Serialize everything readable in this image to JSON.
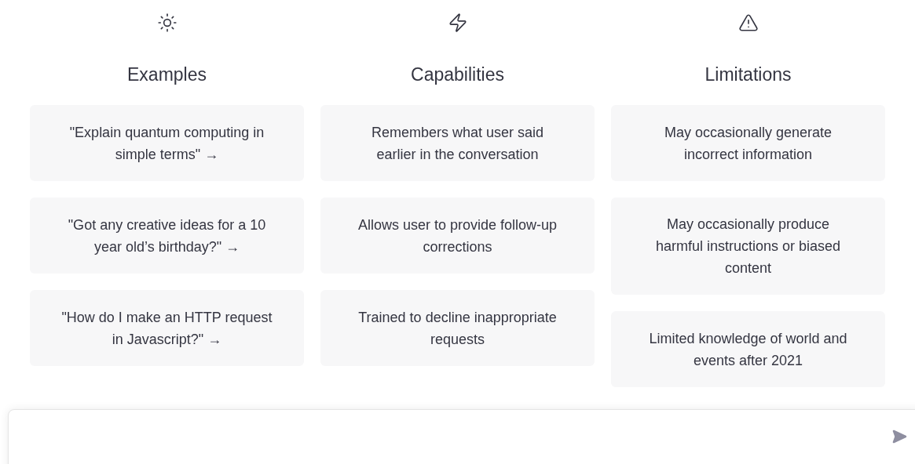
{
  "columns": [
    {
      "kind": "sun",
      "title": "Examples",
      "cards": [
        "\"Explain quantum computing in simple terms\" →",
        "\"Got any creative ideas for a 10 year old’s birthday?\" →",
        "\"How do I make an HTTP request in Javascript?\" →"
      ]
    },
    {
      "kind": "bolt",
      "title": "Capabilities",
      "cards": [
        "Remembers what user said earlier in the conversation",
        "Allows user to provide follow-up corrections",
        "Trained to decline inappropriate requests"
      ]
    },
    {
      "kind": "warning",
      "title": "Limitations",
      "cards": [
        "May occasionally generate incorrect information",
        "May occasionally produce harmful instructions or biased content",
        "Limited knowledge of world and events after 2021"
      ]
    }
  ]
}
